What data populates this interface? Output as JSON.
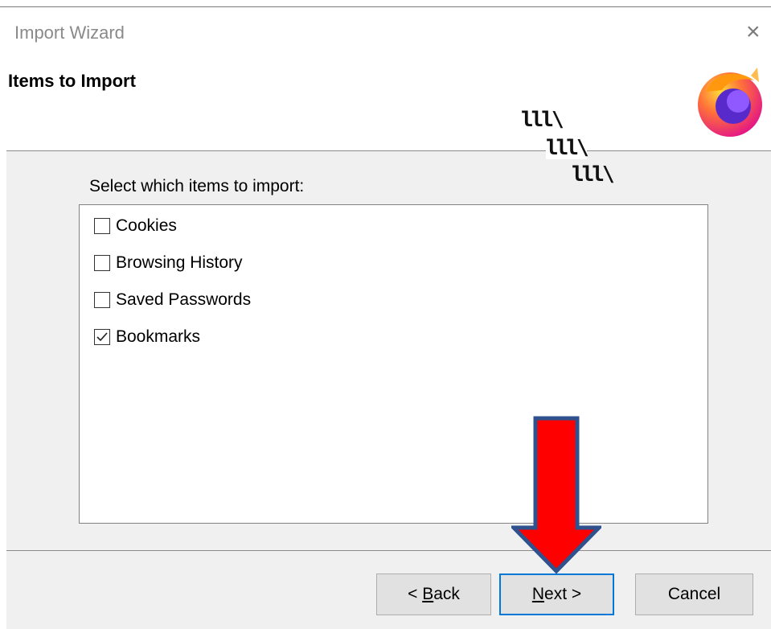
{
  "window": {
    "title": "Import Wizard",
    "close_glyph": "×"
  },
  "header": {
    "heading": "Items to Import",
    "decoration_text": [
      "lll\\",
      "lll\\",
      "lll\\"
    ]
  },
  "main": {
    "prompt": "Select which items to import:",
    "items": [
      {
        "label": "Cookies",
        "checked": false
      },
      {
        "label": "Browsing History",
        "checked": false
      },
      {
        "label": "Saved Passwords",
        "checked": false
      },
      {
        "label": "Bookmarks",
        "checked": true
      }
    ]
  },
  "footer": {
    "back": {
      "prefix": "< ",
      "accel": "B",
      "rest": "ack"
    },
    "next": {
      "accel": "N",
      "rest": "ext >"
    },
    "cancel": "Cancel"
  },
  "colors": {
    "accent": "#0078d7",
    "annotation_arrow": "#ff0000",
    "annotation_outline": "#2f528f",
    "logo_orange": "#ff7139",
    "logo_purple": "#592acb"
  },
  "icons": {
    "logo": "firefox-logo-icon",
    "close": "close-icon",
    "check": "check-icon",
    "annotation": "red-down-arrow-icon"
  }
}
